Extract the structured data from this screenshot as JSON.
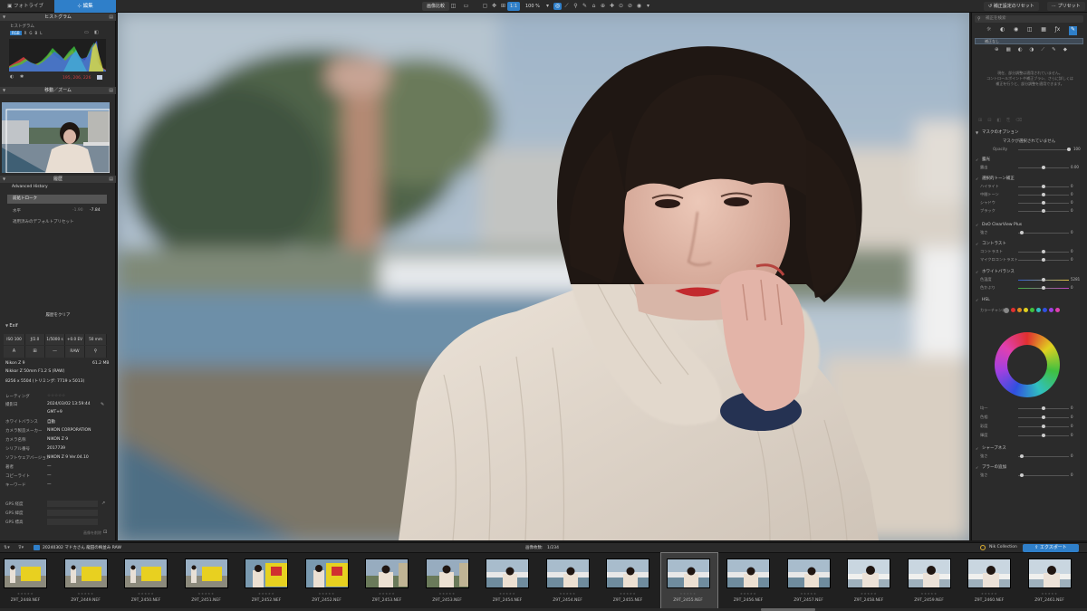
{
  "topbar": {
    "tab_library": "フォトライブラリ",
    "tab_edit": "編集",
    "compare_label": "画像比較",
    "zoom_one": "1:1",
    "zoom_value": "100 %",
    "reset_label": "補正設定のリセット",
    "preset_label": "プリセット"
  },
  "left": {
    "histogram_title": "ヒストグラム",
    "histogram_sub": "ヒストグラム",
    "channels": [
      "RGB",
      "R",
      "G",
      "B",
      "L"
    ],
    "rgb_readout": "195, 206, 226",
    "navigator_title": "移動／ズーム",
    "history_title": "履歴",
    "history_mode": "Advanced History",
    "history_item": "前処トローク",
    "history_row_label": "水平",
    "history_row_val1": "-1.90",
    "history_row_val2": "-7.84",
    "history_preset": "適用済みのデフォルトプリセット",
    "clear_history": "履歴をクリア",
    "exif_title": "Exif",
    "exif_cells": [
      "ISO 100",
      "ƒ/2.0",
      "1/5000 s",
      "+0.0 EV",
      "50 mm"
    ],
    "exif_icons": [
      "A",
      "⊞",
      "—",
      "RAW",
      "⚲"
    ],
    "camera": "Nikon Z 9",
    "filesize": "61.2 MB",
    "lens": "Nikkor Z 50mm F1.2 S (RAW)",
    "dims": "8256 x 5504 (トリミング: 7719 x 5013)",
    "meta": [
      {
        "label": "レーティング",
        "value": "☆☆☆☆☆"
      },
      {
        "label": "撮影日",
        "value": "2024/03/02 13:59:44"
      },
      {
        "label": "",
        "value": "GMT+9"
      },
      {
        "label": "ホワイトバランス",
        "value": "自動"
      },
      {
        "label": "カメラ製造メーカー",
        "value": "NIKON CORPORATION"
      },
      {
        "label": "カメラ名称",
        "value": "NIKON Z 9"
      },
      {
        "label": "シリアル番号",
        "value": "2017739"
      },
      {
        "label": "ソフトウェアバージョン",
        "value": "NIKON Z 9 Ver.04.10"
      },
      {
        "label": "著者",
        "value": "—"
      },
      {
        "label": "コピーライト",
        "value": "—"
      },
      {
        "label": "キーワード",
        "value": "—"
      }
    ],
    "gps": [
      {
        "label": "GPS 経度"
      },
      {
        "label": "GPS 緯度"
      },
      {
        "label": "GPS 標高"
      }
    ],
    "gps_footer": "画像を削除"
  },
  "right": {
    "search_placeholder": "補正を検索",
    "layer_label": "補正なし",
    "mask_info": "現在、部分調整は適用されていません。",
    "mask_info2": "コントロールポイントや補正ブラシ、さらに詳しくは",
    "mask_info3": "補正を行うと、部分調整を適用できます。",
    "mask_options": "マスクのオプション",
    "mask_not_selected": "マスクが選択されていません",
    "opacity_label": "Opacity",
    "opacity_value": "100",
    "sections": [
      {
        "title": "露光",
        "rows": [
          {
            "label": "露出",
            "value": "0.00"
          }
        ]
      },
      {
        "title": "選択的トーン補正",
        "rows": [
          {
            "label": "ハイライト",
            "value": "0"
          },
          {
            "label": "中間トーン",
            "value": "0"
          },
          {
            "label": "シャドウ",
            "value": "0"
          },
          {
            "label": "ブラック",
            "value": "0"
          }
        ]
      },
      {
        "title": "DxO ClearView Plus",
        "rows": [
          {
            "label": "強さ",
            "value": "0"
          }
        ]
      },
      {
        "title": "コントラスト",
        "rows": [
          {
            "label": "コントラスト",
            "value": "0"
          },
          {
            "label": "マイクロコントラスト",
            "value": "0"
          }
        ]
      },
      {
        "title": "ホワイトバランス",
        "rows": [
          {
            "label": "色温度",
            "value": "5281"
          },
          {
            "label": "色かぶり",
            "value": "0"
          }
        ]
      },
      {
        "title": "HSL",
        "rows": []
      }
    ],
    "channel_label": "カラーチャンネル",
    "hsl_rows": [
      {
        "label": "均一",
        "value": "0"
      },
      {
        "label": "色相",
        "value": "0"
      },
      {
        "label": "彩度",
        "value": "0"
      },
      {
        "label": "輝度",
        "value": "0"
      }
    ],
    "sections2": [
      {
        "title": "シャープネス",
        "rows": [
          {
            "label": "強さ",
            "value": "0"
          }
        ]
      },
      {
        "title": "ブラーの追加",
        "rows": [
          {
            "label": "強さ",
            "value": "0"
          }
        ]
      }
    ],
    "colors": [
      "#888888",
      "#e03030",
      "#e08a20",
      "#e0d020",
      "#40c040",
      "#30c0c0",
      "#3050e0",
      "#a040e0",
      "#e040b0"
    ]
  },
  "filmstrip": {
    "folder": "20240302 マドカさん 龍田の梅並み RAW",
    "count": "画像枚数:　1/234",
    "nik": "Nik Collection",
    "export": "エクスポート",
    "items": [
      {
        "name": "Z9T_2448.NEF",
        "variant": "yellow",
        "selected": false
      },
      {
        "name": "Z9T_2449.NEF",
        "variant": "yellow",
        "selected": false
      },
      {
        "name": "Z9T_2450.NEF",
        "variant": "yellow",
        "selected": false
      },
      {
        "name": "Z9T_2451.NEF",
        "variant": "yellow",
        "selected": false
      },
      {
        "name": "Z9T_2452.NEF",
        "variant": "poster",
        "selected": false
      },
      {
        "name": "Z9T_2452.NEF",
        "variant": "poster",
        "selected": false
      },
      {
        "name": "Z9T_2453.NEF",
        "variant": "park",
        "selected": false
      },
      {
        "name": "Z9T_2453.NEF",
        "variant": "park",
        "selected": false
      },
      {
        "name": "Z9T_2454.NEF",
        "variant": "river",
        "selected": false
      },
      {
        "name": "Z9T_2454.NEF",
        "variant": "river",
        "selected": false
      },
      {
        "name": "Z9T_2455.NEF",
        "variant": "river",
        "selected": false
      },
      {
        "name": "Z9T_2455.NEF",
        "variant": "river",
        "selected": true
      },
      {
        "name": "Z9T_2456.NEF",
        "variant": "river",
        "selected": false
      },
      {
        "name": "Z9T_2457.NEF",
        "variant": "river",
        "selected": false
      },
      {
        "name": "Z9T_2458.NEF",
        "variant": "bright",
        "selected": false
      },
      {
        "name": "Z9T_2459.NEF",
        "variant": "bright",
        "selected": false
      },
      {
        "name": "Z9T_2460.NEF",
        "variant": "bright",
        "selected": false
      },
      {
        "name": "Z9T_2461.NEF",
        "variant": "bright",
        "selected": false
      }
    ]
  }
}
